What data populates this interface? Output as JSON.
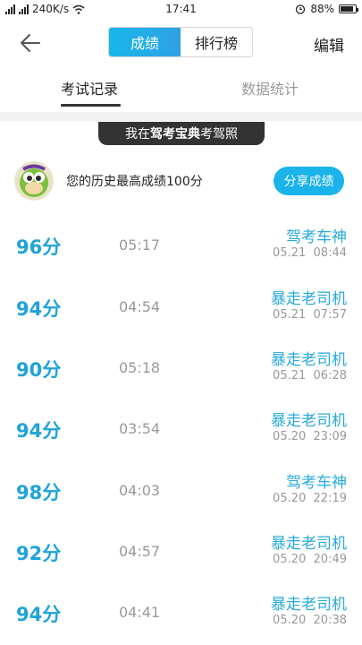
{
  "status_bar": {
    "network_speed": "240K/s",
    "time": "17:41",
    "battery": "88%"
  },
  "header": {
    "tabs": [
      {
        "label": "成绩",
        "active": true
      },
      {
        "label": "排行榜",
        "active": false
      }
    ],
    "edit_label": "编辑",
    "accent_color": "#1ab3ea"
  },
  "sub_tabs": [
    {
      "label": "考试记录",
      "active": true
    },
    {
      "label": "数据统计",
      "active": false
    }
  ],
  "banner": {
    "prefix": "我在",
    "brand": "驾考宝典",
    "suffix": "考驾照"
  },
  "user": {
    "best_score_text": "您的历史最高成绩100分",
    "share_label": "分享成绩"
  },
  "records": [
    {
      "score": "96分",
      "duration": "05:17",
      "title": "驾考车神",
      "date": "05.21",
      "time": "08:44"
    },
    {
      "score": "94分",
      "duration": "04:54",
      "title": "暴走老司机",
      "date": "05.21",
      "time": "07:57"
    },
    {
      "score": "90分",
      "duration": "05:18",
      "title": "暴走老司机",
      "date": "05.21",
      "time": "06:28"
    },
    {
      "score": "94分",
      "duration": "03:54",
      "title": "暴走老司机",
      "date": "05.20",
      "time": "23:09"
    },
    {
      "score": "98分",
      "duration": "04:03",
      "title": "驾考车神",
      "date": "05.20",
      "time": "22:19"
    },
    {
      "score": "92分",
      "duration": "04:57",
      "title": "暴走老司机",
      "date": "05.20",
      "time": "20:49"
    },
    {
      "score": "94分",
      "duration": "04:41",
      "title": "暴走老司机",
      "date": "05.20",
      "time": "20:38"
    }
  ]
}
